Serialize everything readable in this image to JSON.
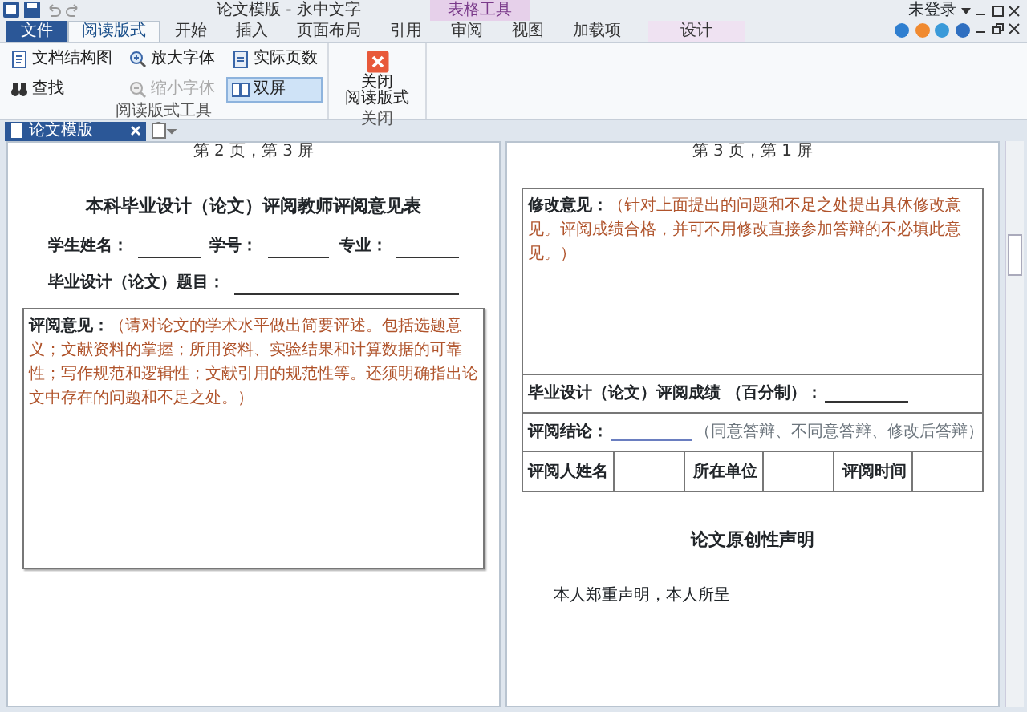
{
  "window": {
    "title": "论文模版 - 永中文字",
    "account": "未登录"
  },
  "contextual_group": "表格工具",
  "ribbon_tabs": [
    {
      "label": "文件",
      "kind": "file",
      "selected": false
    },
    {
      "label": "阅读版式",
      "kind": "tab",
      "selected": true
    },
    {
      "label": "开始",
      "kind": "tab",
      "selected": false
    },
    {
      "label": "插入",
      "kind": "tab",
      "selected": false
    },
    {
      "label": "页面布局",
      "kind": "tab",
      "selected": false
    },
    {
      "label": "引用",
      "kind": "tab",
      "selected": false
    },
    {
      "label": "审阅",
      "kind": "tab",
      "selected": false
    },
    {
      "label": "视图",
      "kind": "tab",
      "selected": false
    },
    {
      "label": "加载项",
      "kind": "tab",
      "selected": false
    },
    {
      "label": "设计",
      "kind": "contextual",
      "selected": false
    }
  ],
  "ribbon_groups": [
    {
      "label": "阅读版式工具",
      "columns": [
        [
          {
            "label": "文档结构图",
            "disabled": false,
            "selected": false
          },
          {
            "label": "查找",
            "disabled": false,
            "selected": false
          }
        ],
        [
          {
            "label": "放大字体",
            "disabled": false,
            "selected": false
          },
          {
            "label": "缩小字体",
            "disabled": true,
            "selected": false
          }
        ],
        [
          {
            "label": "实际页数",
            "disabled": false,
            "selected": false
          },
          {
            "label": "双屏",
            "disabled": false,
            "selected": true
          }
        ]
      ]
    },
    {
      "label": "关闭",
      "columns": [
        [
          {
            "label": "关闭",
            "label2": "阅读版式",
            "kind": "large",
            "disabled": false,
            "selected": false
          }
        ]
      ]
    }
  ],
  "document_tabs": [
    {
      "label": "论文模版",
      "selected": true
    }
  ],
  "pages": [
    {
      "header": "第 2 页，第 3 屏",
      "blocks": [
        {
          "kind": "heading",
          "text": "本科毕业设计（论文）评阅教师评阅意见表"
        },
        {
          "kind": "fields",
          "fields": [
            "学生姓名：",
            "学号：",
            "专业："
          ]
        },
        {
          "kind": "fields",
          "fields": [
            "毕业设计（论文）题目："
          ]
        },
        {
          "kind": "opinion",
          "label": "评阅意见：",
          "hint": "（请对论文的学术水平做出简要评述。包括选题意义；文献资料的掌握；所用资料、实验结果和计算数据的可靠性；写作规范和逻辑性；文献引用的规范性等。还须明确指出论文中存在的问题和不足之处。）"
        }
      ]
    },
    {
      "header": "第 3 页，第 1 屏",
      "blocks": [
        {
          "kind": "form",
          "rows": [
            {
              "kind": "opinion",
              "label": "修改意见：",
              "hint": "（针对上面提出的问题和不足之处提出具体修改意见。评阅成绩合格，并可不用修改直接参加答辩的不必填此意见。）"
            },
            {
              "kind": "score",
              "label": "毕业设计（论文）评阅成绩 （百分制）："
            },
            {
              "kind": "conclusion",
              "label": "评阅结论：",
              "note": "（同意答辩、不同意答辩、修改后答辩）"
            },
            {
              "kind": "cells",
              "cells": [
                "评阅人姓名",
                "",
                "所在单位",
                "",
                "评阅时间",
                ""
              ]
            }
          ]
        },
        {
          "kind": "heading",
          "text": "论文原创性声明"
        },
        {
          "kind": "paragraph",
          "text": "本人郑重声明，本人所呈"
        }
      ]
    }
  ]
}
